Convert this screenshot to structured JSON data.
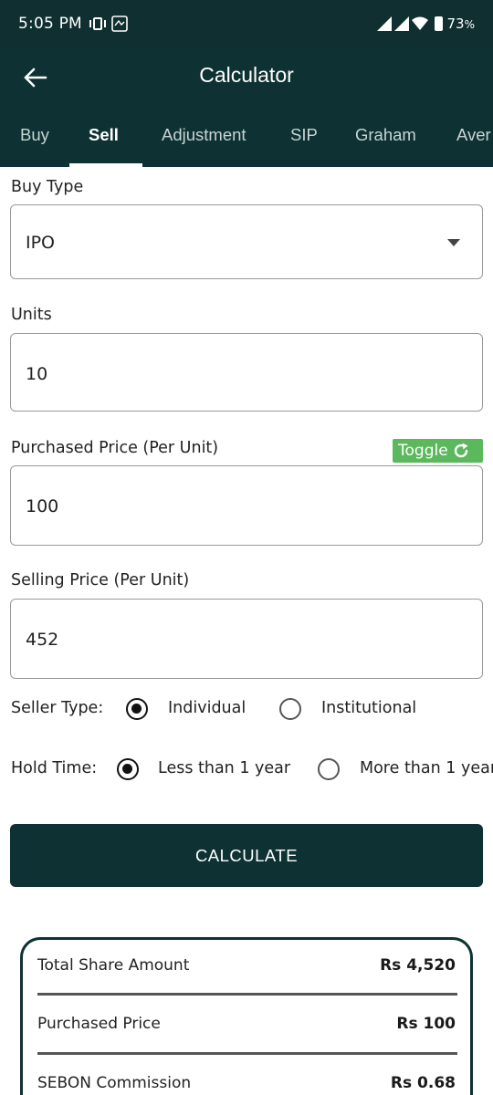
{
  "status_bar": {
    "time": "5:05 PM",
    "battery": "73",
    "battery_unit": "%"
  },
  "header": {
    "title": "Calculator"
  },
  "tabs": [
    {
      "label": "Buy",
      "active": false
    },
    {
      "label": "Sell",
      "active": true
    },
    {
      "label": "Adjustment",
      "active": false
    },
    {
      "label": "SIP",
      "active": false
    },
    {
      "label": "Graham",
      "active": false
    },
    {
      "label": "Aver",
      "active": false
    }
  ],
  "form": {
    "buy_type": {
      "label": "Buy Type",
      "value": "IPO"
    },
    "units": {
      "label": "Units",
      "value": "10"
    },
    "purchased_price": {
      "label": "Purchased Price (Per Unit)",
      "value": "100",
      "toggle_label": "Toggle"
    },
    "selling_price": {
      "label": "Selling Price (Per Unit)",
      "value": "452"
    },
    "seller_type": {
      "label": "Seller Type:",
      "options": [
        {
          "label": "Individual",
          "selected": true
        },
        {
          "label": "Institutional",
          "selected": false
        }
      ]
    },
    "hold_time": {
      "label": "Hold Time:",
      "options": [
        {
          "label": "Less than 1 year",
          "selected": true
        },
        {
          "label": "More than 1 year",
          "selected": false
        }
      ]
    },
    "calculate_label": "CALCULATE"
  },
  "results": [
    {
      "label": "Total Share Amount",
      "value": "Rs 4,520"
    },
    {
      "label": "Purchased Price",
      "value": "Rs 100"
    },
    {
      "label": "SEBON Commission",
      "value": "Rs 0.68"
    }
  ],
  "colors": {
    "primary": "#0e3233",
    "toggle": "#5cb85c",
    "background": "#ffffff"
  }
}
